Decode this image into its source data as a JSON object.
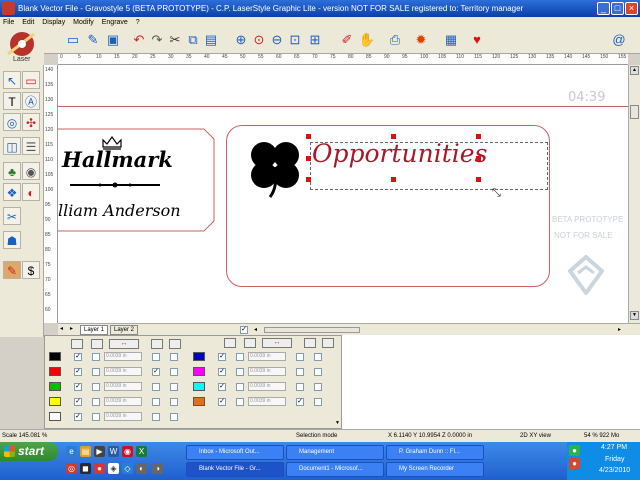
{
  "window": {
    "title": "Blank Vector File - Gravostyle 5 (BETA PROTOTYPE) - C.P. LaserStyle Graphic Lite - version NOT FOR SALE registered to: Territory manager",
    "minimize": "_",
    "maximize": "□",
    "close": "×"
  },
  "menu": [
    "File",
    "Edit",
    "Display",
    "Modify",
    "Engrave",
    "?"
  ],
  "logo_label": "Laser",
  "canvas": {
    "time_overlay": "04:39",
    "hallmark_brand": "Hallmark",
    "name_text": "lliam  Anderson",
    "opportunities_text": "Opportunities",
    "watermark_line1": "BETA PROTOTYPE",
    "watermark_line2": "NOT FOR SALE"
  },
  "ruler_h": [
    "0",
    "5",
    "10",
    "15",
    "20",
    "25",
    "30",
    "35",
    "40",
    "45",
    "50",
    "55",
    "60",
    "65",
    "70",
    "75",
    "80",
    "85",
    "90",
    "95",
    "100",
    "105",
    "110",
    "115",
    "120",
    "125",
    "130",
    "135",
    "140",
    "145",
    "150",
    "155"
  ],
  "ruler_v": [
    "140",
    "135",
    "130",
    "125",
    "120",
    "115",
    "110",
    "105",
    "100",
    "95",
    "90",
    "85",
    "80",
    "75",
    "70",
    "65",
    "60"
  ],
  "layers": {
    "tab1": "Layer 1",
    "tab2": "Layer 2"
  },
  "color_rows_left": [
    {
      "color": "#000000",
      "v1": true,
      "v2": false,
      "value": "0.0039 in",
      "v3": false,
      "v4": false
    },
    {
      "color": "#ff0000",
      "v1": true,
      "v2": false,
      "value": "0.0039 in",
      "v3": true,
      "v4": false
    },
    {
      "color": "#00c000",
      "v1": true,
      "v2": false,
      "value": "0.0039 in",
      "v3": false,
      "v4": false
    },
    {
      "color": "#ffff00",
      "v1": true,
      "v2": false,
      "value": "0.0039 in",
      "v3": false,
      "v4": false
    },
    {
      "color": "#ffffff",
      "v1": true,
      "v2": false,
      "value": "0.0039 in",
      "v3": false,
      "v4": false
    }
  ],
  "color_rows_right": [
    {
      "color": "#0000c0",
      "v1": true,
      "v2": false,
      "value": "0.0039 in",
      "v3": false,
      "v4": false
    },
    {
      "color": "#ff00ff",
      "v1": true,
      "v2": false,
      "value": "0.0039 in",
      "v3": false,
      "v4": false
    },
    {
      "color": "#00ffff",
      "v1": true,
      "v2": false,
      "value": "0.0039 in",
      "v3": false,
      "v4": false
    },
    {
      "color": "#e07020",
      "v1": true,
      "v2": false,
      "value": "0.0039 in",
      "v3": true,
      "v4": false
    }
  ],
  "status": {
    "scale": "Scale 145.081 %",
    "mode": "Selection mode",
    "coords": "X 6.1140  Y 10.9954  Z 0.0000 in",
    "view": "2D XY view",
    "memory": "54 % 922 Mo"
  },
  "taskbar": {
    "start": "start",
    "row1": [
      "Inbox - Microsoft Out...",
      "Management",
      "P. Graham Dunn :: Fl..."
    ],
    "row2": [
      "Blank Vector File - Gr...",
      "Document1 - Microsof...",
      "My Screen Recorder"
    ],
    "clock": "4:27 PM",
    "day": "Friday",
    "date": "4/23/2010"
  }
}
